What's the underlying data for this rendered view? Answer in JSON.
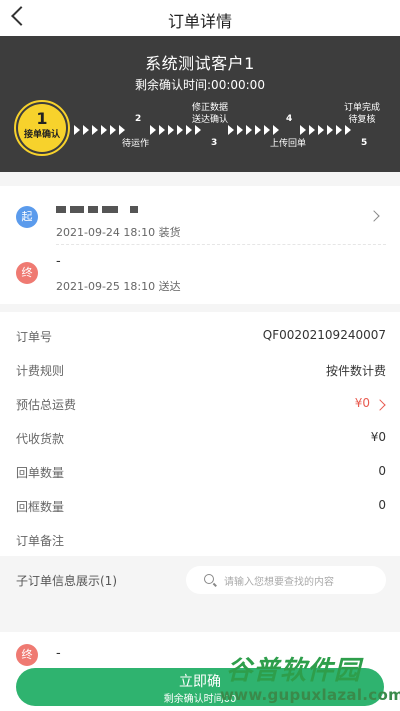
{
  "navbar": {
    "title": "订单详情",
    "back_icon": "chevron-left-icon"
  },
  "hero": {
    "title": "系统测试客户1",
    "countdown": "剩余确认时间:00:00:00",
    "current_step": {
      "number": "1",
      "label": "接单确认"
    },
    "steps": [
      {
        "number": "2",
        "label": "待运作"
      },
      {
        "number": "3",
        "label": "修正数据\n送达确认"
      },
      {
        "number": "4",
        "label": "上传回单"
      },
      {
        "number": "5",
        "label": "订单完成\n待复核"
      }
    ],
    "accent_color": "#f7d22c"
  },
  "route": {
    "start": {
      "badge": "起",
      "address": "",
      "time": "2021-09-24 18:10 装货"
    },
    "end": {
      "badge": "终",
      "address": "-",
      "time": "2021-09-25 18:10 送达"
    }
  },
  "info": {
    "order_no_label": "订单号",
    "order_no_value": "QF00202109240007",
    "billing_label": "计费规则",
    "billing_value": "按件数计费",
    "freight_label": "预估总运费",
    "freight_value": "¥0",
    "cod_label": "代收货款",
    "cod_value": "¥0",
    "receipt_qty_label": "回单数量",
    "receipt_qty_value": "0",
    "frame_qty_label": "回框数量",
    "frame_qty_value": "0",
    "remark_label": "订单备注"
  },
  "sub_orders": {
    "title": "子订单信息展示(1)",
    "search_placeholder": "请输入您想要查找的内容",
    "end_badge": "终",
    "end_address": "-"
  },
  "confirm": {
    "label": "立即确",
    "sub": "剩余确认时间00"
  },
  "watermark": {
    "top": "谷普软件园",
    "url": "www.gupuxlazal.com"
  }
}
